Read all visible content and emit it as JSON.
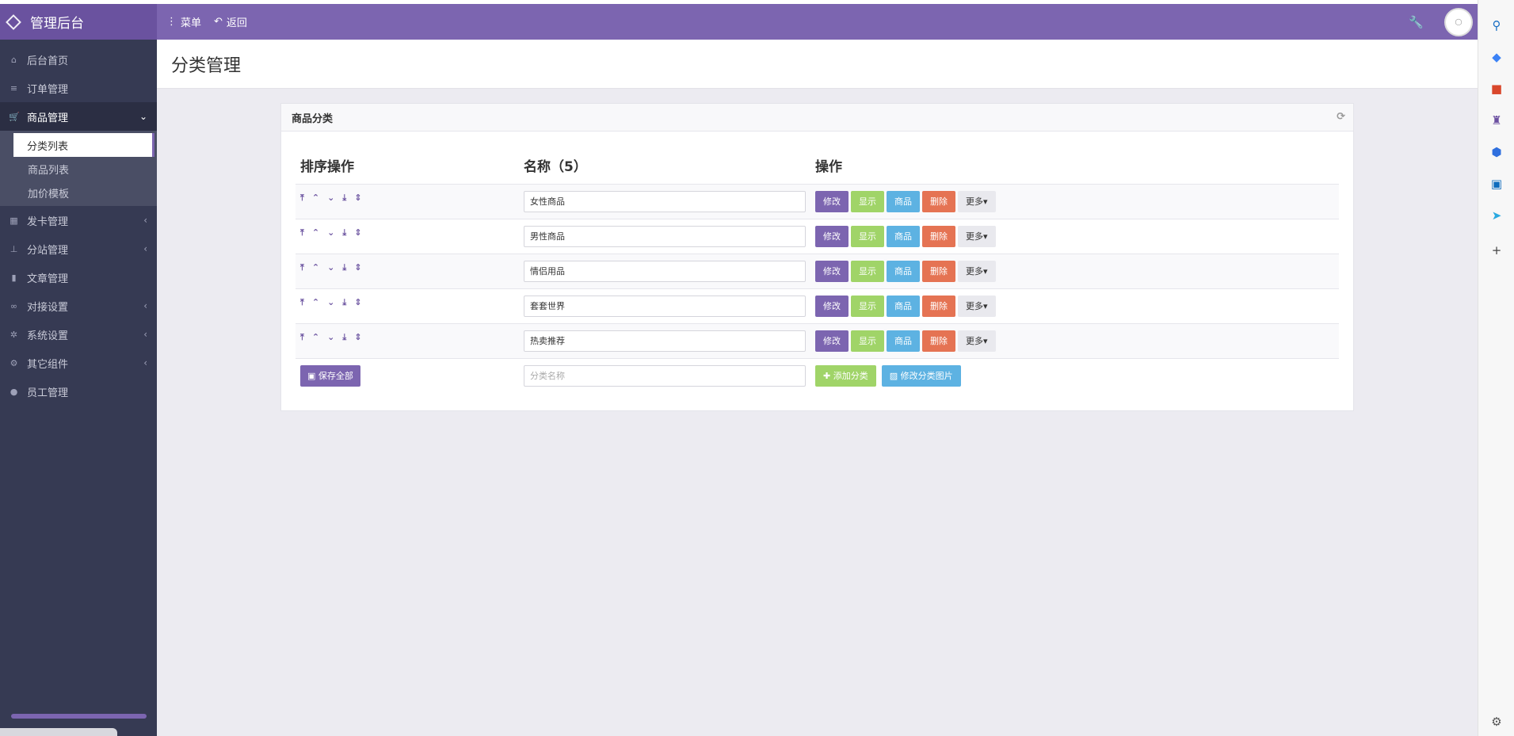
{
  "header": {
    "brand": "管理后台",
    "menu_label": "菜单",
    "back_label": "返回"
  },
  "sidebar": {
    "items": [
      {
        "label": "后台首页",
        "icon": "home-icon"
      },
      {
        "label": "订单管理",
        "icon": "list-icon"
      },
      {
        "label": "商品管理",
        "icon": "cart-icon",
        "expanded": true
      },
      {
        "label": "发卡管理",
        "icon": "grid-icon"
      },
      {
        "label": "分站管理",
        "icon": "sitemap-icon"
      },
      {
        "label": "文章管理",
        "icon": "book-icon"
      },
      {
        "label": "对接设置",
        "icon": "link-icon"
      },
      {
        "label": "系统设置",
        "icon": "gear-icon"
      },
      {
        "label": "其它组件",
        "icon": "cogs-icon"
      },
      {
        "label": "员工管理",
        "icon": "user-icon"
      }
    ],
    "subitems": [
      "分类列表",
      "商品列表",
      "加价模板"
    ]
  },
  "page": {
    "title": "分类管理"
  },
  "panel": {
    "title": "商品分类",
    "columns": [
      "排序操作",
      "名称（5）",
      "操作"
    ],
    "rows": [
      {
        "name": "女性商品"
      },
      {
        "name": "男性商品"
      },
      {
        "name": "情侣用品"
      },
      {
        "name": "套套世界"
      },
      {
        "name": "热卖推荐"
      }
    ],
    "row_buttons": {
      "edit": "修改",
      "show": "显示",
      "goods": "商品",
      "delete": "删除",
      "more": "更多"
    },
    "footer": {
      "save_all": "保存全部",
      "new_name_placeholder": "分类名称",
      "add_category": "添加分类",
      "edit_images": "修改分类图片"
    }
  },
  "colors": {
    "primary": "#7c65b0",
    "sidebar_bg": "#363a53",
    "show": "#a0d468",
    "goods": "#5db2e2",
    "delete": "#e57353"
  }
}
